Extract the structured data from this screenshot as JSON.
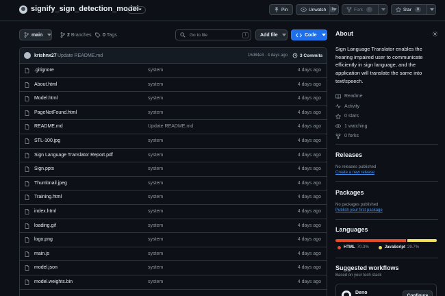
{
  "repo": {
    "name": "signify_sign_detection_model-",
    "visibility": "Public"
  },
  "actions": {
    "pin_label": "Pin",
    "unwatch_label": "Unwatch",
    "unwatch_count": "1",
    "fork_label": "Fork",
    "fork_count": "0",
    "star_label": "Star",
    "star_count": "0"
  },
  "nav": {
    "branch": "main",
    "branches_count": "2",
    "branches_label": "Branches",
    "tags_count": "0",
    "tags_label": "Tags",
    "search_placeholder": "Go to file",
    "search_shortcut": "t",
    "add_file_label": "Add file",
    "code_label": "Code"
  },
  "latest_commit": {
    "author": "krishnx27",
    "message": "Update README.md",
    "hash_time": "15d84e3 · 4 days ago",
    "commits_label": "3 Commits"
  },
  "files": [
    {
      "name": ".gitignore",
      "commit": "system",
      "date": "4 days ago"
    },
    {
      "name": "About.html",
      "commit": "system",
      "date": "4 days ago"
    },
    {
      "name": "Model.html",
      "commit": "system",
      "date": "4 days ago"
    },
    {
      "name": "PageNotFound.html",
      "commit": "system",
      "date": "4 days ago"
    },
    {
      "name": "README.md",
      "commit": "Update README.md",
      "date": "4 days ago"
    },
    {
      "name": "STL-100.jpg",
      "commit": "system",
      "date": "4 days ago"
    },
    {
      "name": "Sign Language Translator Report.pdf",
      "commit": "system",
      "date": "4 days ago"
    },
    {
      "name": "Sign.pptx",
      "commit": "system",
      "date": "4 days ago"
    },
    {
      "name": "Thumbnail.jpeg",
      "commit": "system",
      "date": "4 days ago"
    },
    {
      "name": "Training.html",
      "commit": "system",
      "date": "4 days ago"
    },
    {
      "name": "index.html",
      "commit": "system",
      "date": "4 days ago"
    },
    {
      "name": "loading.gif",
      "commit": "system",
      "date": "4 days ago"
    },
    {
      "name": "logo.png",
      "commit": "system",
      "date": "4 days ago"
    },
    {
      "name": "main.js",
      "commit": "system",
      "date": "4 days ago"
    },
    {
      "name": "model.json",
      "commit": "system",
      "date": "4 days ago"
    },
    {
      "name": "model.weights.bin",
      "commit": "system",
      "date": "4 days ago"
    }
  ],
  "about": {
    "heading": "About",
    "description": "Sign Language Translator enables the hearing impaired user to communicate efficiently in sign language, and the application will translate the same into text/speech.",
    "readme_label": "Readme",
    "activity_label": "Activity",
    "stars_label": "0 stars",
    "watching_label": "1 watching",
    "forks_label": "0 forks"
  },
  "releases": {
    "heading": "Releases",
    "empty_text": "No releases published",
    "create_link": "Create a new release"
  },
  "packages": {
    "heading": "Packages",
    "empty_text": "No packages published",
    "publish_link": "Publish your first package"
  },
  "languages": {
    "heading": "Languages",
    "items": [
      {
        "name": "HTML",
        "percent": "70.3%",
        "value": 70.3,
        "color": "#e34c26"
      },
      {
        "name": "JavaScript",
        "percent": "29.7%",
        "value": 29.7,
        "color": "#f1e05a"
      }
    ]
  },
  "workflows": {
    "heading": "Suggested workflows",
    "subheading": "Based on your tech stack",
    "card_name": "Deno",
    "configure_label": "Configure"
  }
}
